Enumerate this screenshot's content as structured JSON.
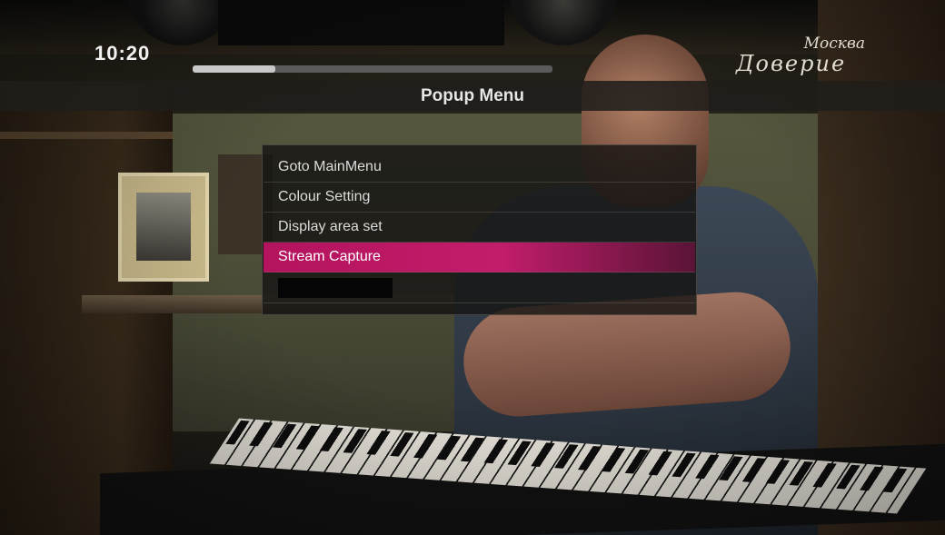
{
  "osd": {
    "clock": "10:20",
    "playback_progress_fraction": 0.23
  },
  "channel_logo": {
    "city": "Москва",
    "word": "Доверие"
  },
  "popup": {
    "title": "Popup Menu",
    "items": [
      {
        "label": "Goto MainMenu",
        "selected": false
      },
      {
        "label": "Colour Setting",
        "selected": false
      },
      {
        "label": "Display area set",
        "selected": false
      },
      {
        "label": "Stream Capture",
        "selected": true
      }
    ]
  },
  "colors": {
    "highlight": "#c21d6b",
    "title_bar_bg": "#201e1a",
    "text": "#dcdcdc"
  }
}
